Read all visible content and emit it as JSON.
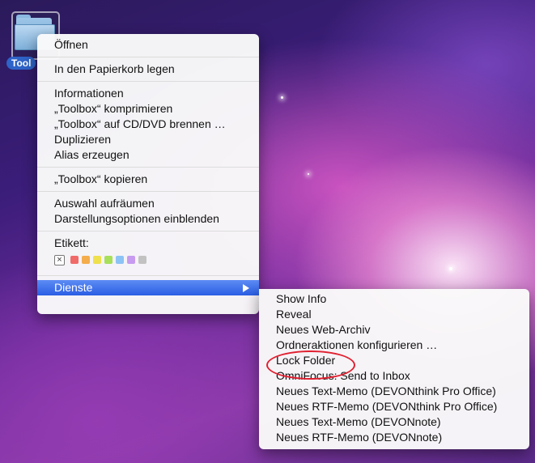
{
  "desktop": {
    "folder": {
      "label": "Tool"
    }
  },
  "context_menu": {
    "items": {
      "open": "Öffnen",
      "trash": "In den Papierkorb legen",
      "info": "Informationen",
      "compress": "„Toolbox“ komprimieren",
      "burn": "„Toolbox“ auf CD/DVD brennen …",
      "duplicate": "Duplizieren",
      "alias": "Alias erzeugen",
      "copy": "„Toolbox“ kopieren",
      "cleanup": "Auswahl aufräumen",
      "view_options": "Darstellungsoptionen einblenden",
      "label_heading": "Etikett:",
      "services": "Dienste"
    },
    "label_colors": [
      "#f06a6a",
      "#f4ad4c",
      "#efe04e",
      "#a7df5a",
      "#8cc3f5",
      "#c79bf0",
      "#c2c2c2"
    ],
    "label_clear_symbol": "×"
  },
  "services_menu": {
    "items": [
      "Show Info",
      "Reveal",
      "Neues Web-Archiv",
      "Ordneraktionen konfigurieren …",
      "Lock Folder",
      "OmniFocus: Send to Inbox",
      "Neues Text-Memo (DEVONthink Pro Office)",
      "Neues RTF-Memo (DEVONthink Pro Office)",
      "Neues Text-Memo (DEVONnote)",
      "Neues RTF-Memo (DEVONnote)"
    ]
  },
  "annotation": {
    "color": "#e02030"
  }
}
